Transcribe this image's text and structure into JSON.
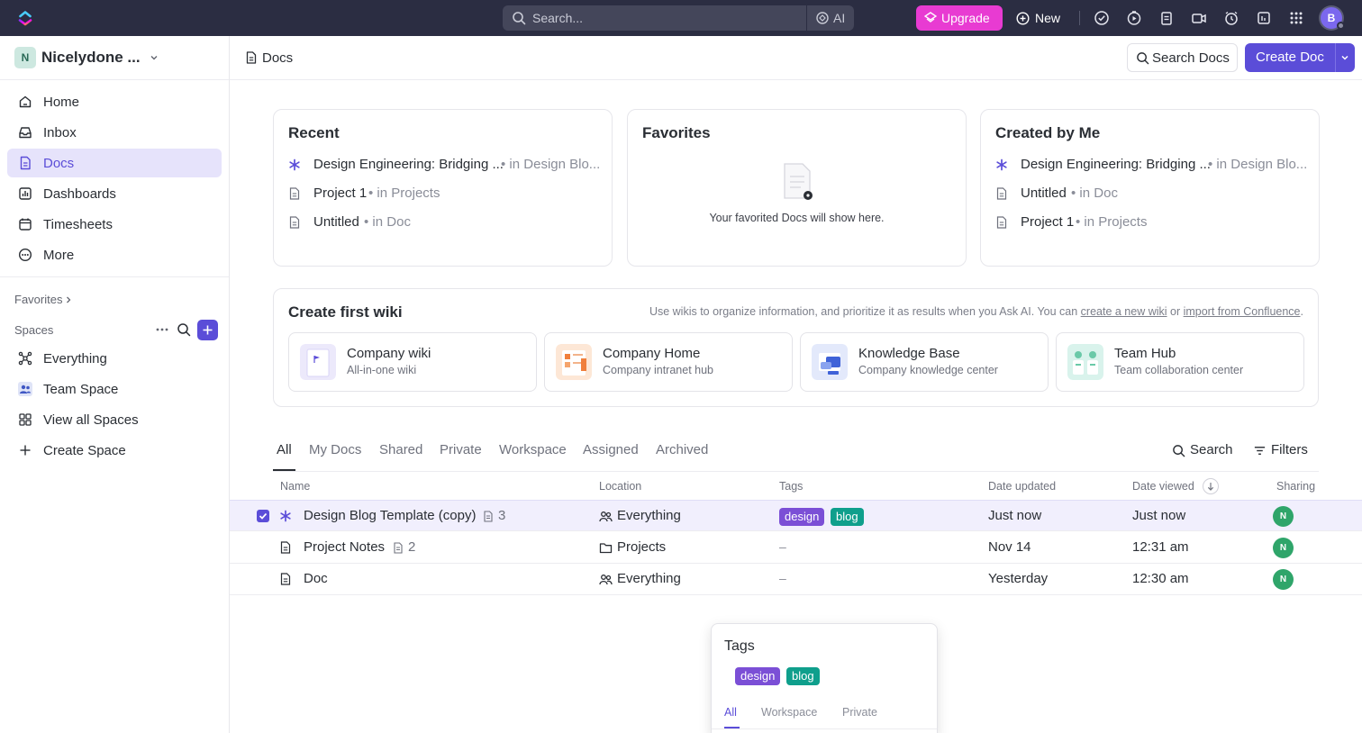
{
  "topbar": {
    "search_placeholder": "Search...",
    "ai_label": "AI",
    "upgrade_label": "Upgrade",
    "new_label": "New",
    "avatar_initial": "B",
    "colors": {
      "bar": "#2b2d42",
      "upgrade": "#e83bd2",
      "accent": "#5b4dd8"
    }
  },
  "sidebar": {
    "workspace_initial": "N",
    "workspace_name": "Nicelydone ...",
    "nav": [
      {
        "label": "Home",
        "icon": "home-icon"
      },
      {
        "label": "Inbox",
        "icon": "inbox-icon"
      },
      {
        "label": "Docs",
        "icon": "docs-icon",
        "active": true
      },
      {
        "label": "Dashboards",
        "icon": "dashboards-icon"
      },
      {
        "label": "Timesheets",
        "icon": "timesheets-icon"
      },
      {
        "label": "More",
        "icon": "more-icon"
      }
    ],
    "favorites_label": "Favorites",
    "spaces_label": "Spaces",
    "spaces": [
      {
        "label": "Everything",
        "icon": "everything-icon"
      },
      {
        "label": "Team Space",
        "icon": "team-space-icon"
      },
      {
        "label": "View all Spaces",
        "icon": "view-spaces-icon"
      },
      {
        "label": "Create Space",
        "icon": "plus-icon"
      }
    ]
  },
  "header": {
    "title": "Docs",
    "search_docs_label": "Search Docs",
    "create_doc_label": "Create Doc"
  },
  "cards": {
    "recent": {
      "title": "Recent",
      "rows": [
        {
          "name": "Design Engineering: Bridging ...",
          "meta": "in Design Blo..."
        },
        {
          "name": "Project 1",
          "meta": "in Projects"
        },
        {
          "name": "Untitled",
          "meta": "in Doc"
        }
      ]
    },
    "favorites": {
      "title": "Favorites",
      "empty_text": "Your favorited Docs will show here."
    },
    "created": {
      "title": "Created by Me",
      "rows": [
        {
          "name": "Design Engineering: Bridging ...",
          "meta": "in Design Blo..."
        },
        {
          "name": "Untitled",
          "meta": "in Doc"
        },
        {
          "name": "Project 1",
          "meta": "in Projects"
        }
      ]
    }
  },
  "wiki": {
    "title": "Create first wiki",
    "help_prefix": "Use wikis to organize information, and prioritize it as results when you Ask AI. You can ",
    "help_link1": "create a new wiki",
    "help_mid": " or ",
    "help_link2": "import from Confluence",
    "help_suffix": ".",
    "templates": [
      {
        "title": "Company wiki",
        "subtitle": "All-in-one wiki"
      },
      {
        "title": "Company Home",
        "subtitle": "Company intranet hub"
      },
      {
        "title": "Knowledge Base",
        "subtitle": "Company knowledge center"
      },
      {
        "title": "Team Hub",
        "subtitle": "Team collaboration center"
      }
    ]
  },
  "tabs": [
    "All",
    "My Docs",
    "Shared",
    "Private",
    "Workspace",
    "Assigned",
    "Archived"
  ],
  "tools": {
    "search_label": "Search",
    "filters_label": "Filters"
  },
  "table": {
    "headers": [
      "Name",
      "Location",
      "Tags",
      "Date updated",
      "Date viewed",
      "Sharing"
    ],
    "rows": [
      {
        "name": "Design Blog Template (copy)",
        "sub_count": "3",
        "location": "Everything",
        "tags": [
          "design",
          "blog"
        ],
        "updated": "Just now",
        "viewed": "Just now",
        "sharing": "N",
        "selected": true
      },
      {
        "name": "Project Notes",
        "sub_count": "2",
        "location": "Projects",
        "tags": "–",
        "updated": "Nov 14",
        "viewed": "12:31 am",
        "sharing": "N"
      },
      {
        "name": "Doc",
        "location": "Everything",
        "tags": "–",
        "updated": "Yesterday",
        "viewed": "12:30 am",
        "sharing": "N"
      }
    ],
    "tag_colors": {
      "design": "#7b4fd6",
      "blog": "#0f9f8c"
    }
  },
  "tags_popup": {
    "title": "Tags",
    "tags": [
      "design",
      "blog"
    ],
    "tabs": [
      "All",
      "Workspace",
      "Private"
    ]
  }
}
